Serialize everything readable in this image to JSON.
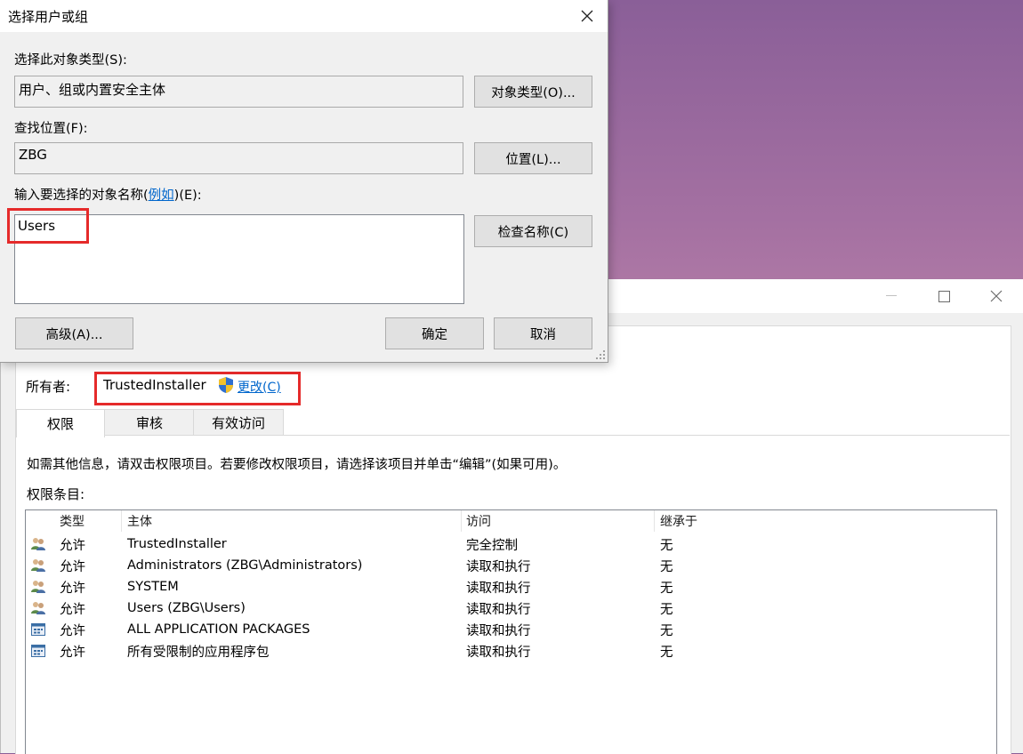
{
  "dialog": {
    "title": "选择用户或组",
    "object_type_label": "选择此对象类型(S):",
    "object_type_value": "用户、组或内置安全主体",
    "object_type_button": "对象类型(O)...",
    "location_label": "查找位置(F):",
    "location_value": "ZBG",
    "location_button": "位置(L)...",
    "names_label_prefix": "输入要选择的对象名称(",
    "names_label_link": "例如",
    "names_label_suffix": ")(E):",
    "names_value": "Users",
    "check_names_button": "检查名称(C)",
    "advanced_button": "高级(A)...",
    "ok_button": "确定",
    "cancel_button": "取消",
    "close_glyph": "✕"
  },
  "security_window": {
    "owner_label": "所有者:",
    "owner_value": "TrustedInstaller",
    "change_link": "更改(C)",
    "tabs": [
      "权限",
      "审核",
      "有效访问"
    ],
    "info_text": "如需其他信息，请双击权限项目。若要修改权限项目，请选择该项目并单击“编辑”(如果可用)。",
    "entries_label": "权限条目:",
    "columns": [
      "类型",
      "主体",
      "访问",
      "继承于"
    ],
    "rows": [
      {
        "icon": "user-group-icon",
        "type": "允许",
        "principal": "TrustedInstaller",
        "access": "完全控制",
        "inherited": "无"
      },
      {
        "icon": "user-group-icon",
        "type": "允许",
        "principal": "Administrators (ZBG\\Administrators)",
        "access": "读取和执行",
        "inherited": "无"
      },
      {
        "icon": "user-group-icon",
        "type": "允许",
        "principal": "SYSTEM",
        "access": "读取和执行",
        "inherited": "无"
      },
      {
        "icon": "user-group-icon",
        "type": "允许",
        "principal": "Users (ZBG\\Users)",
        "access": "读取和执行",
        "inherited": "无"
      },
      {
        "icon": "app-package-icon",
        "type": "允许",
        "principal": "ALL APPLICATION PACKAGES",
        "access": "读取和执行",
        "inherited": "无"
      },
      {
        "icon": "app-package-icon",
        "type": "允许",
        "principal": "所有受限制的应用程序包",
        "access": "读取和执行",
        "inherited": "无"
      }
    ]
  },
  "colors": {
    "highlight": "#e52a2a",
    "link": "#0066cc"
  }
}
